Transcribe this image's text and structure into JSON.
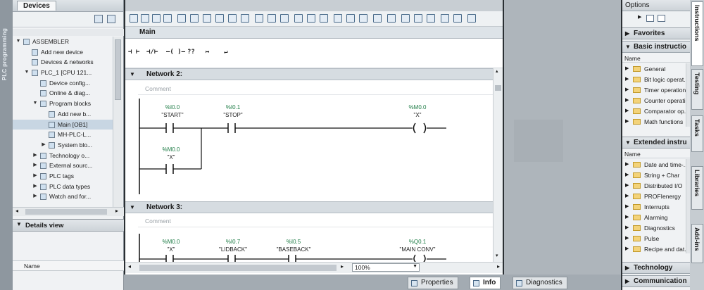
{
  "left_strip": {
    "label": "PLC programming"
  },
  "devices": {
    "tab_label": "Devices",
    "tree": [
      {
        "label": "ASSEMBLER",
        "indent": 0,
        "arrow": "▼"
      },
      {
        "label": "Add new device",
        "indent": 1,
        "arrow": ""
      },
      {
        "label": "Devices & networks",
        "indent": 1,
        "arrow": ""
      },
      {
        "label": "PLC_1 [CPU 121...",
        "indent": 1,
        "arrow": "▼"
      },
      {
        "label": "Device config...",
        "indent": 2,
        "arrow": ""
      },
      {
        "label": "Online & diag...",
        "indent": 2,
        "arrow": ""
      },
      {
        "label": "Program blocks",
        "indent": 2,
        "arrow": "▼"
      },
      {
        "label": "Add new b...",
        "indent": 3,
        "arrow": ""
      },
      {
        "label": "Main [OB1]",
        "indent": 3,
        "arrow": "",
        "selected": true
      },
      {
        "label": "MH-PLC-L...",
        "indent": 3,
        "arrow": ""
      },
      {
        "label": "System blo...",
        "indent": 3,
        "arrow": "▶"
      },
      {
        "label": "Technology o...",
        "indent": 2,
        "arrow": "▶"
      },
      {
        "label": "External sourc...",
        "indent": 2,
        "arrow": "▶"
      },
      {
        "label": "PLC tags",
        "indent": 2,
        "arrow": "▶"
      },
      {
        "label": "PLC data types",
        "indent": 2,
        "arrow": "▶"
      },
      {
        "label": "Watch and for...",
        "indent": 2,
        "arrow": "▶"
      }
    ],
    "details_view": "Details view",
    "details_column": "Name"
  },
  "editor": {
    "title": "Main",
    "ladder_tools": [
      "⊣ ⊢",
      "⊣/⊢",
      "–( )–",
      "??",
      "↦",
      "↵"
    ],
    "network2": {
      "title": "Network 2:",
      "comment": "Comment",
      "contacts": [
        {
          "addr": "%I0.0",
          "name": "\"START\""
        },
        {
          "addr": "%I0.1",
          "name": "\"STOP\""
        },
        {
          "addr": "%M0.0",
          "name": "\"X\""
        }
      ],
      "coil": {
        "addr": "%M0.0",
        "name": "\"X\""
      }
    },
    "network3": {
      "title": "Network 3:",
      "comment": "Comment",
      "contacts": [
        {
          "addr": "%M0.0",
          "name": "\"X\""
        },
        {
          "addr": "%I0.7",
          "name": "\"LIDBACK\""
        },
        {
          "addr": "%I0.5",
          "name": "\"BASEBACK\""
        }
      ],
      "coil": {
        "addr": "%Q0.1",
        "name": "\"MAIN CONV\""
      }
    },
    "zoom": "100%"
  },
  "bottom_tabs": [
    "Properties",
    "Info",
    "Diagnostics"
  ],
  "options": {
    "title": "Options",
    "favorites": "Favorites",
    "basic_instructions": {
      "title": "Basic instructio",
      "column": "Name",
      "items": [
        "General",
        "Bit logic operat...",
        "Timer operations",
        "Counter operation",
        "Comparator op...",
        "Math functions"
      ]
    },
    "extended_instructions": {
      "title": "Extended instru",
      "column": "Name",
      "items": [
        "Date and time-...",
        "String + Char",
        "Distributed I/O",
        "PROFIenergy",
        "Interrupts",
        "Alarming",
        "Diagnostics",
        "Pulse",
        "Recipe and dat..."
      ]
    },
    "technology": "Technology",
    "communication": "Communication"
  },
  "vertical_tabs": [
    "Instructions",
    "Testing",
    "Tasks",
    "Libraries",
    "Add-ins"
  ]
}
